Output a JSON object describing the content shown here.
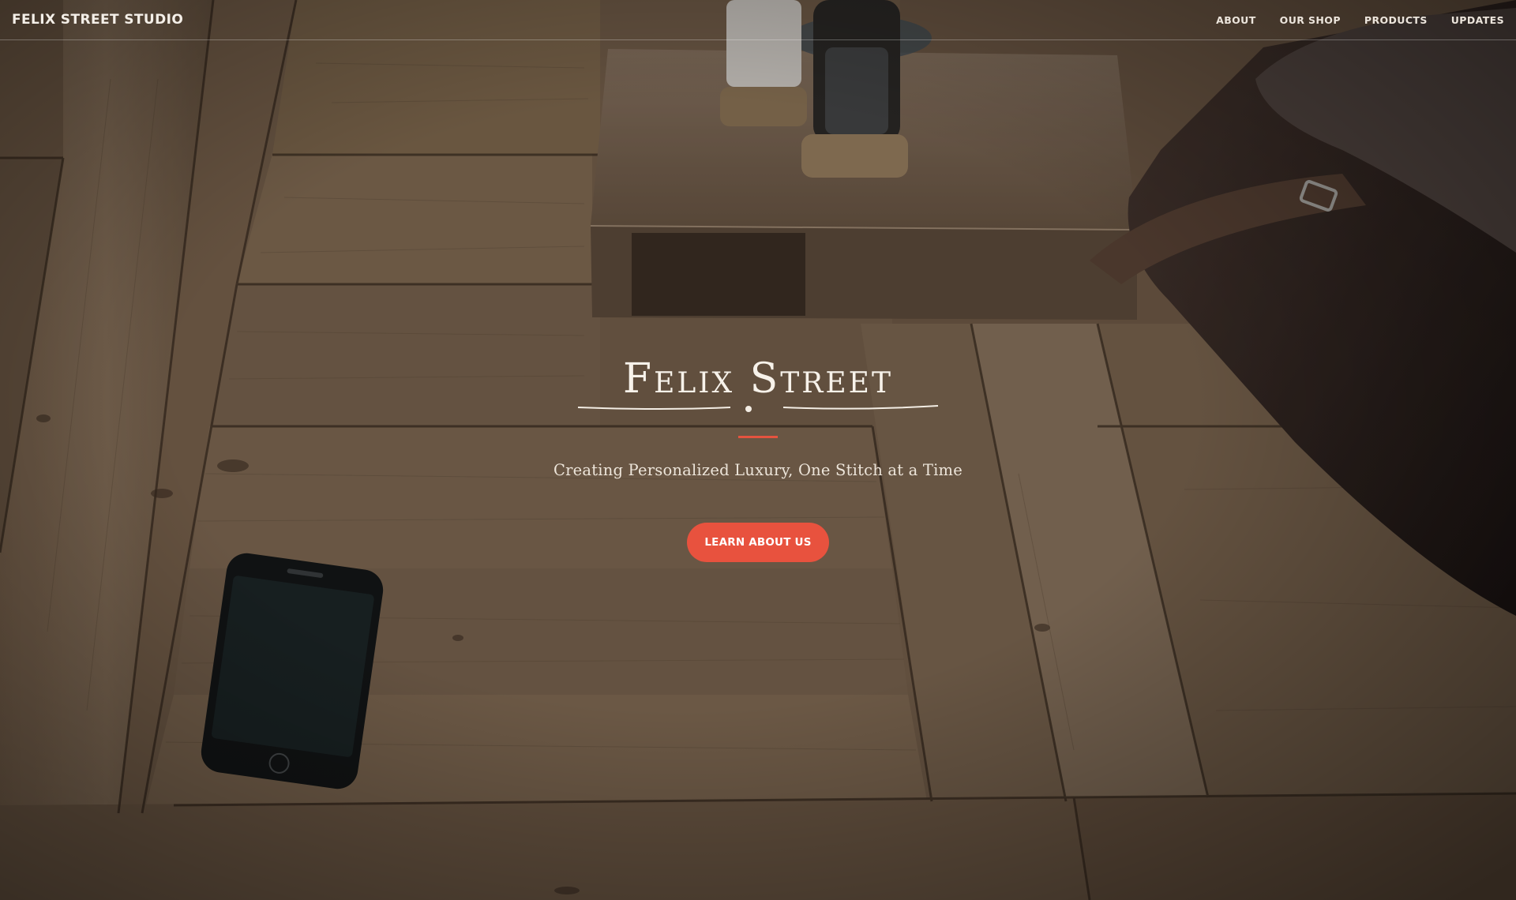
{
  "site": {
    "brand": "FELIX STREET STUDIO"
  },
  "nav": {
    "items": [
      {
        "label": "ABOUT"
      },
      {
        "label": "OUR SHOP"
      },
      {
        "label": "PRODUCTS"
      },
      {
        "label": "UPDATES"
      }
    ]
  },
  "hero": {
    "logo_text": "Felix Street",
    "tagline": "Creating Personalized Luxury, One Stitch at a Time",
    "cta_label": "LEARN ABOUT US"
  },
  "colors": {
    "accent": "#e8523e",
    "text_light": "#f4efe8"
  },
  "icons": {
    "scene": "wood-floor-photo"
  }
}
